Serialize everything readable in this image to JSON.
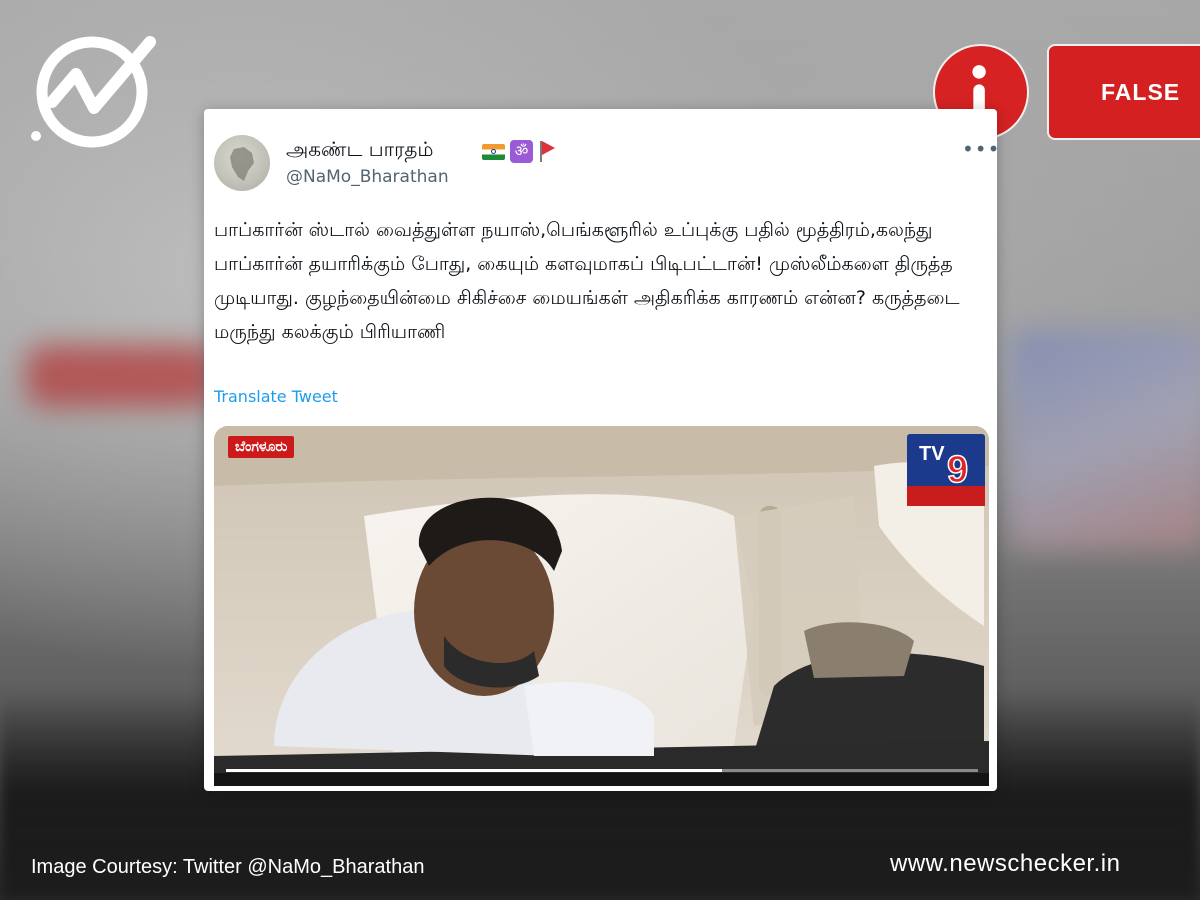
{
  "brand": {
    "logo_icon": "newschecker-check-logo-icon",
    "site_url": "www.newschecker.in",
    "accent_color": "#d42020"
  },
  "verdict": {
    "info_icon": "info-icon",
    "label": "FALSE",
    "color": "#d42020"
  },
  "tweet": {
    "display_name": "அகண்ட பாரதம்",
    "display_emojis": [
      "india-flag-icon",
      "om-icon",
      "triangular-flag-icon"
    ],
    "handle": "@NaMo_Bharathan",
    "more_icon": "more-options-icon",
    "text": "பாப்கார்ன் ஸ்டால் வைத்துள்ள நயாஸ்,பெங்களூரில் உப்புக்கு பதில் மூத்திரம்,கலந்து பாப்கார்ன் தயாரிக்கும் போது, கையும் களவுமாகப் பிடிபட்டான்! முஸ்லீம்களை திருத்த முடியாது. குழந்தையின்மை சிகிச்சை மையங்கள் அதிகரிக்க காரணம் என்ன? கருத்தடை மருந்து கலக்கும் பிரியாணி",
    "translate_label": "Translate Tweet",
    "media": {
      "location_tag": "ಬೆಂಗಳೂರು",
      "channel_logo": "tv9-kannada-logo-icon",
      "channel_text": "9",
      "playback_progress": 0.66
    }
  },
  "footer": {
    "credit": "Image Courtesy: Twitter @NaMo_Bharathan"
  }
}
